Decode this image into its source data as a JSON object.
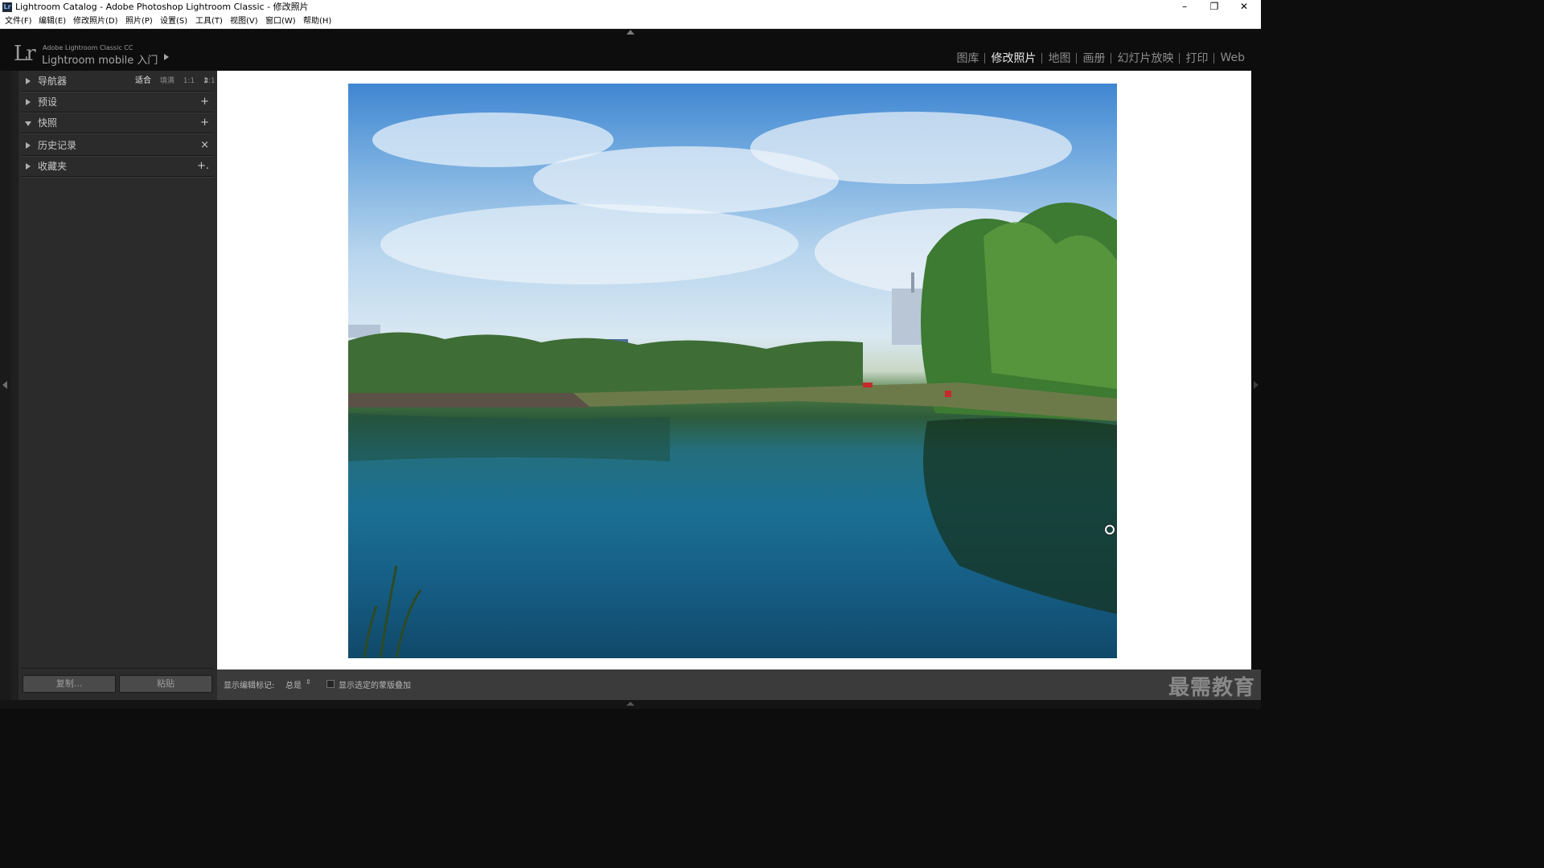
{
  "window": {
    "title": "Lightroom Catalog - Adobe Photoshop Lightroom Classic - 修改照片",
    "app_icon": "Lr"
  },
  "menubar": {
    "items": [
      "文件(F)",
      "编辑(E)",
      "修改照片(D)",
      "照片(P)",
      "设置(S)",
      "工具(T)",
      "视图(V)",
      "窗口(W)",
      "帮助(H)"
    ]
  },
  "identity_plate": {
    "logo": "Lr",
    "small_text": "Adobe Lightroom Classic CC",
    "mobile_text": "Lightroom mobile 入门"
  },
  "modules": {
    "items": [
      "图库",
      "修改照片",
      "地图",
      "画册",
      "幻灯片放映",
      "打印",
      "Web"
    ],
    "active": "修改照片"
  },
  "left_panel": {
    "sections": [
      {
        "label": "导航器",
        "action": "⇕",
        "open": false
      },
      {
        "label": "预设",
        "action": "+",
        "open": false
      },
      {
        "label": "快照",
        "action": "+",
        "open": true
      },
      {
        "label": "历史记录",
        "action": "×",
        "open": false
      },
      {
        "label": "收藏夹",
        "action": "+.",
        "open": false
      }
    ],
    "navigator_options": [
      "适合",
      "填满",
      "1:1",
      "2:1"
    ],
    "navigator_selected": "适合",
    "copy_button": "复制...",
    "paste_button": "粘贴"
  },
  "toolbar": {
    "show_edit_pins_label": "显示编辑标记:",
    "show_edit_pins_value": "总是",
    "show_mask_overlay_label": "显示选定的蒙版叠加",
    "show_mask_overlay_checked": false
  },
  "watermark": "最需教育",
  "icons": {
    "minimize": "minimize-icon",
    "restore": "restore-icon",
    "close": "close-icon"
  }
}
